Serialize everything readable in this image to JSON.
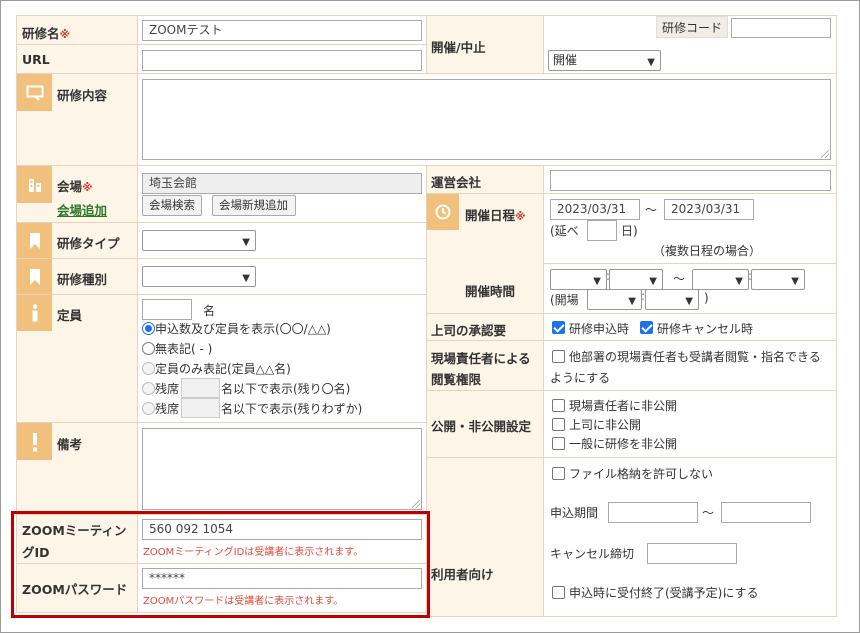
{
  "form": {
    "course_name": {
      "label": "研修名",
      "required_mark": "※",
      "value": "ZOOMテスト"
    },
    "url": {
      "label": "URL",
      "value": ""
    },
    "content": {
      "label": "研修内容",
      "value": ""
    },
    "status": {
      "label": "開催/中止",
      "course_code_label": "研修コード",
      "course_code_value": "",
      "selected": "開催"
    },
    "venue": {
      "label": "会場",
      "required_mark": "※",
      "add_link": "会場追加",
      "value": "埼玉会館",
      "search_button": "会場検索",
      "new_button": "会場新規追加"
    },
    "operator": {
      "label": "運営会社",
      "value": ""
    },
    "dates": {
      "label": "開催日程",
      "required_mark": "※",
      "start": "2023/03/31",
      "tilde": "〜",
      "end": "2023/03/31",
      "total_prefix": "(延べ",
      "total_suffix": "日)",
      "multi_note": "（複数日程の場合）"
    },
    "time": {
      "label": "開催時間",
      "tilde": "〜",
      "open_prefix": "(開場",
      "close_paren": ")"
    },
    "course_type": {
      "label": "研修タイプ",
      "selected": ""
    },
    "course_kind": {
      "label": "研修種別",
      "selected": ""
    },
    "capacity": {
      "label": "定員",
      "unit": "名",
      "options": [
        {
          "label": "申込数及び定員を表示(〇〇/△△)",
          "checked": true
        },
        {
          "label": "無表記( - )",
          "checked": false
        },
        {
          "label": "定員のみ表記(定員△△名)",
          "checked": false
        },
        {
          "label_prefix": "残席",
          "label_suffix": "名以下で表示(残り〇名)",
          "checked": false
        },
        {
          "label_prefix": "残席",
          "label_suffix": "名以下で表示(残りわずか)",
          "checked": false
        }
      ]
    },
    "notes": {
      "label": "備考",
      "value": ""
    },
    "approval": {
      "label": "上司の承認要",
      "opt1": "研修申込時",
      "opt1_checked": true,
      "opt2": "研修キャンセル時",
      "opt2_checked": true
    },
    "viewer_rights": {
      "label_line1": "現場責任者による",
      "label_line2": "閲覧権限",
      "text_line1": "他部署の現場責任者も受講者閲覧・指名できる",
      "text_line2": "ようにする"
    },
    "visibility": {
      "label": "公開・非公開設定",
      "opt1": "現場責任者に非公開",
      "opt2": "上司に非公開",
      "opt3": "一般に研修を非公開"
    },
    "for_users": {
      "label": "利用者向け",
      "file_opt": "ファイル格納を許可しない",
      "apply_period_label": "申込期間",
      "tilde": "〜",
      "cancel_deadline_label": "キャンセル締切",
      "auto_close": "申込時に受付終了(受講予定)にする"
    },
    "zoom_id": {
      "label_line1": "ZOOMミーティン",
      "label_line2": "グID",
      "value": "560 092 1054",
      "note": "ZOOMミーティングIDは受講者に表示されます。"
    },
    "zoom_pass": {
      "label": "ZOOMパスワード",
      "value": "******",
      "note": "ZOOMパスワードは受講者に表示されます。"
    }
  },
  "colors": {
    "header_bg": "#fdf5e8",
    "icon_bg": "#f0c07c",
    "required": "#d23a2a",
    "note": "#e24a3a",
    "highlight_border": "#c00000",
    "checkbox": "#1a73e8"
  }
}
